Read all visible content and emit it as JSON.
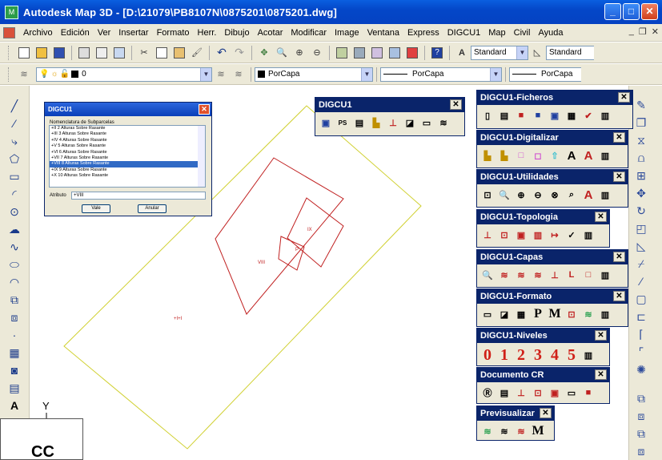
{
  "window": {
    "title": "Autodesk Map 3D - [D:\\21079\\PB8107N\\0875201\\0875201.dwg]"
  },
  "menu": [
    "Archivo",
    "Edición",
    "Ver",
    "Insertar",
    "Formato",
    "Herr.",
    "Dibujo",
    "Acotar",
    "Modificar",
    "Image",
    "Ventana",
    "Express",
    "DIGCU1",
    "Map",
    "Civil",
    "Ayuda"
  ],
  "toolbar": {
    "text_style": "Standard",
    "dim_style": "Standard"
  },
  "layers": {
    "current_layer": "0",
    "color": "PorCapa",
    "linetype": "PorCapa",
    "lineweight": "PorCapa"
  },
  "drawing": {
    "labels": [
      "IX",
      "VIII",
      "P",
      "+I+I"
    ],
    "ucs_y": "Y",
    "ucs_text": "CC"
  },
  "dialog": {
    "title": "DIGCU1",
    "list_label": "Nomenclatura de Subparcelas",
    "items": [
      "+II  2 Alturas Sobre Rasante",
      "+III 3 Alturas Sobre Rasante",
      "+IV  4 Alturas Sobre Rasante",
      "+V   5 Alturas Sobre Rasante",
      "+VI  6 Alturas Sobre Rasante",
      "+VII 7 Alturas Sobre Rasante",
      "+VIII 8 Alturas Sobre Rasante",
      "+IX  9 Alturas Sobre Rasante",
      "+X  10 Alturas Sobre Rasante"
    ],
    "selected_index": 6,
    "attr_label": "Atributo",
    "attr_value": "+VIII",
    "ok": "Vale",
    "cancel": "Anular"
  },
  "toolbars": [
    {
      "title": "DIGCU1"
    },
    {
      "title": "DIGCU1-Ficheros"
    },
    {
      "title": "DIGCU1-Digitalizar"
    },
    {
      "title": "DIGCU1-Utilidades"
    },
    {
      "title": "DIGCU1-Topologia"
    },
    {
      "title": "DIGCU1-Capas"
    },
    {
      "title": "DIGCU1-Formato"
    },
    {
      "title": "DIGCU1-Niveles",
      "levels": [
        "0",
        "1",
        "2",
        "3",
        "4",
        "5"
      ]
    },
    {
      "title": "Documento CR"
    },
    {
      "title": "Previsualizar"
    }
  ],
  "colors": {
    "titlebar": "#0542c2",
    "plot": "#d0d030",
    "building": "#c02020",
    "panel_header": "#0a246a"
  }
}
